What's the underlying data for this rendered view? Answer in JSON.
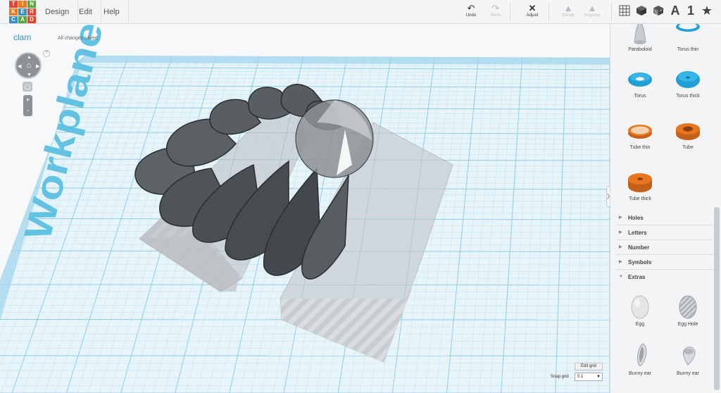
{
  "app": {
    "logo_letters": [
      "T",
      "I",
      "N",
      "K",
      "E",
      "R",
      "C",
      "A",
      "D"
    ],
    "logo_colors": [
      "#e8412c",
      "#f07a1a",
      "#5aa63c",
      "#f07a1a",
      "#3b8fc7",
      "#e8412c",
      "#3b8fc7",
      "#5aa63c",
      "#e8412c"
    ]
  },
  "menu": {
    "design": "Design",
    "edit": "Edit",
    "help": "Help"
  },
  "toolbar": {
    "undo": "Undo",
    "redo": "Redo",
    "adjust": "Adjust",
    "group": "Group",
    "ungroup": "Ungroup",
    "view_letter": "A",
    "view_number": "1"
  },
  "viewport": {
    "title": "clam",
    "save_status": "All changes saved",
    "workplane_label": "Workplane",
    "help": "?",
    "edit_grid": "Edit grid",
    "snap_grid_label": "Snap grid",
    "snap_grid_value": "0.1"
  },
  "panel": {
    "shapes": [
      {
        "name": "Paraboloid",
        "icon": "paraboloid-icon",
        "color": "#c8ccd0"
      },
      {
        "name": "Torus thin",
        "icon": "torus-thin-icon",
        "color": "#1e9fd6"
      },
      {
        "name": "Torus",
        "icon": "torus-icon",
        "color": "#1e9fd6"
      },
      {
        "name": "Torus thick",
        "icon": "torus-thick-icon",
        "color": "#1e9fd6"
      },
      {
        "name": "Tube thin",
        "icon": "tube-thin-icon",
        "color": "#e8761e"
      },
      {
        "name": "Tube",
        "icon": "tube-icon",
        "color": "#e8761e"
      },
      {
        "name": "Tube thick",
        "icon": "tube-thick-icon",
        "color": "#e8761e"
      }
    ],
    "categories": [
      {
        "label": "Holes",
        "expanded": false
      },
      {
        "label": "Letters",
        "expanded": false
      },
      {
        "label": "Number",
        "expanded": false
      },
      {
        "label": "Symbols",
        "expanded": false
      },
      {
        "label": "Extras",
        "expanded": true
      }
    ],
    "extras": [
      {
        "name": "Egg",
        "icon": "egg-icon"
      },
      {
        "name": "Egg Hole",
        "icon": "egg-hole-icon"
      },
      {
        "name": "Bunny ear",
        "icon": "bunny-ear-icon"
      },
      {
        "name": "Bunny ear",
        "icon": "bunny-ear-alt-icon"
      }
    ]
  }
}
